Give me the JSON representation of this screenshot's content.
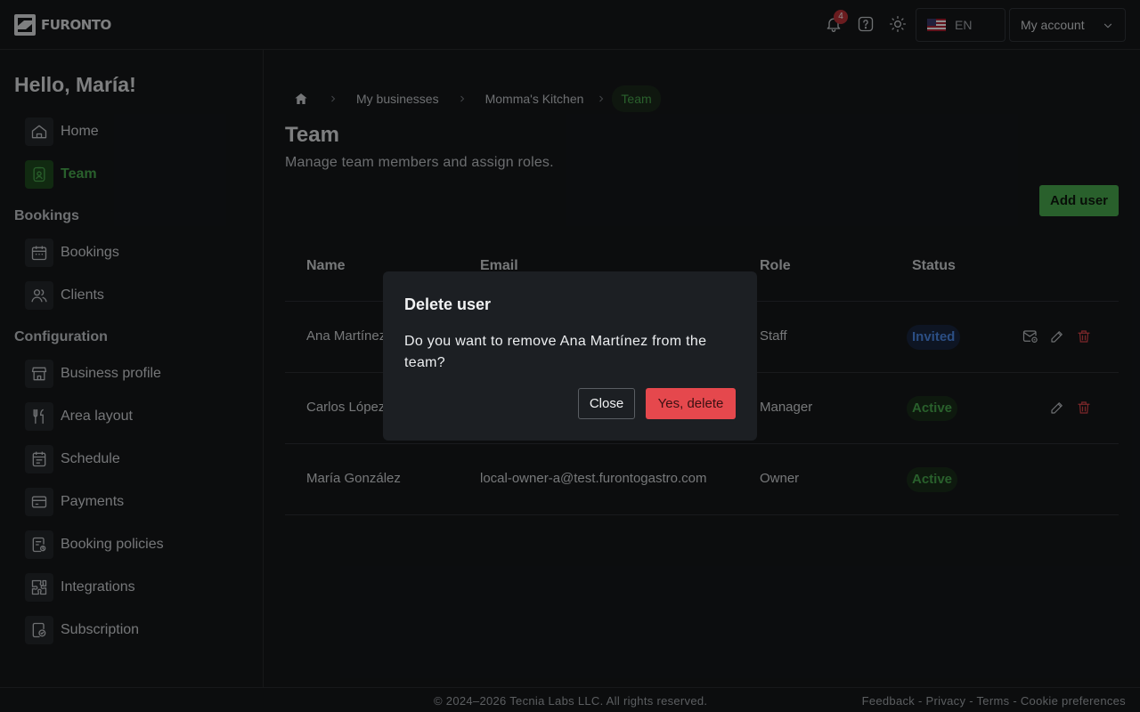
{
  "header": {
    "brand": "FURONTO",
    "notifications_count": "4",
    "language": "EN",
    "account_label": "My account"
  },
  "sidebar": {
    "greeting": "Hello, María!",
    "items": [
      {
        "label": "Home",
        "icon": "home-icon",
        "active": false
      },
      {
        "label": "Team",
        "icon": "team-badge-icon",
        "active": true
      }
    ],
    "sections": [
      {
        "title": "Bookings",
        "items": [
          {
            "label": "Bookings",
            "icon": "calendar-icon"
          },
          {
            "label": "Clients",
            "icon": "users-icon"
          }
        ]
      },
      {
        "title": "Configuration",
        "items": [
          {
            "label": "Business profile",
            "icon": "store-icon"
          },
          {
            "label": "Area layout",
            "icon": "fork-knife-icon"
          },
          {
            "label": "Schedule",
            "icon": "schedule-icon"
          },
          {
            "label": "Payments",
            "icon": "credit-card-icon"
          },
          {
            "label": "Booking policies",
            "icon": "policy-icon"
          },
          {
            "label": "Integrations",
            "icon": "puzzle-icon"
          },
          {
            "label": "Subscription",
            "icon": "subscription-icon"
          }
        ]
      }
    ]
  },
  "breadcrumb": {
    "items": [
      "My businesses",
      "Momma's Kitchen"
    ],
    "current": "Team"
  },
  "page": {
    "title": "Team",
    "subtitle": "Manage team members and assign roles.",
    "add_user_label": "Add user"
  },
  "table": {
    "columns": [
      "Name",
      "Email",
      "Role",
      "Status"
    ],
    "rows": [
      {
        "name": "Ana Martínez",
        "email": "",
        "role": "Staff",
        "status": "Invited"
      },
      {
        "name": "Carlos López",
        "email": "",
        "role": "Manager",
        "status": "Active"
      },
      {
        "name": "María González",
        "email": "local-owner-a@test.furontogastro.com",
        "role": "Owner",
        "status": "Active"
      }
    ]
  },
  "footer": {
    "copyright": "© 2024–2026 Tecnia Labs LLC. All rights reserved.",
    "links": [
      "Feedback",
      "Privacy",
      "Terms",
      "Cookie preferences"
    ]
  },
  "modal": {
    "title": "Delete user",
    "body": "Do you want to remove Ana Martínez from the team?",
    "close_label": "Close",
    "confirm_label": "Yes, delete"
  },
  "colors": {
    "accent_green": "#4caf50",
    "danger_red": "#e5484d",
    "invited_blue": "#4f8ff0",
    "background": "#16181b"
  }
}
